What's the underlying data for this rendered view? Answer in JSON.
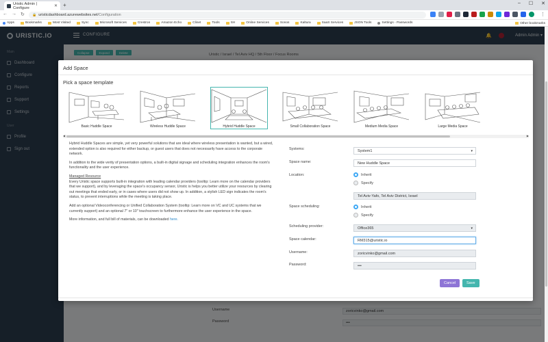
{
  "browser": {
    "tab_title": "Uristic Admin | Configure",
    "url_host": "uristicdashboard.azurewebsites.net",
    "url_path": "/Configuration",
    "bookmarks": [
      "Apps",
      "Bookmarks",
      "Most Visited",
      "Sync",
      "Microsoft Services",
      "Crestron",
      "Amazon Echo",
      "Clinet",
      "Tools",
      "SH",
      "Online Services",
      "Sonos",
      "Kaltura",
      "SaaS Services",
      "JSON Tools",
      "Settings - Passwords"
    ],
    "other_bookmarks": "Other bookmarks"
  },
  "app": {
    "logo": "URISTIC.IO",
    "page_header": "CONFIGURE",
    "user_name": "Admin Admin",
    "sidebar": {
      "main_section": "Main",
      "main_items": [
        "Dashboard",
        "Configure",
        "Reports",
        "Support",
        "Settings"
      ],
      "user_section": "User",
      "user_items": [
        "Profile",
        "Sign out"
      ]
    },
    "breadcrumb": "Uristic  /  Israel  /  Tel Aviv HQ  /  5th Floor  /  Focus Rooms",
    "bg_buttons": [
      "Collapse",
      "Expand",
      "Delete"
    ],
    "bg_rows": [
      {
        "label": "Username",
        "value": "zoricvinko@gmail.com"
      },
      {
        "label": "Password",
        "value": "•••"
      }
    ]
  },
  "modal": {
    "title": "Add Space",
    "pick_title": "Pick a space template",
    "templates": [
      {
        "name": "Basic Huddle Space",
        "selected": false
      },
      {
        "name": "Wireless Huddle Space",
        "selected": false
      },
      {
        "name": "Hybrid Huddle Space",
        "selected": true
      },
      {
        "name": "Small Collaboration Space",
        "selected": false
      },
      {
        "name": "Medium Media Space",
        "selected": false
      },
      {
        "name": "Large Media Space",
        "selected": false
      }
    ],
    "description": {
      "p1": "Hybrid Huddle Spaces are simple, yet very powerful solutions that are ideal where wireless presentation is wanted, but a wired, extended option is also required for either backup, or guest users that does not necessarily have access to the corporate network.",
      "p2": "In addition to the wide verity of presentation options, a built-in digital signage and scheduling integration enhances the room's functionality and the user experience.",
      "managed_heading": "Managed Resource",
      "p3": "Every Uristic space supports built-in integration with leading calendar providers (tooltip: Learn more on the calendar providers that we support), and by leveraging the space's occupancy sensor, Uristic is helps you better utilize your resources by clearing out meetings that ended early, or in cases where users did not show up. In addition, a stylish LED sign indicates the room's status, to prevent interruptions while the meeting is taking place.",
      "p4": "Add an optional Videoconferencing or Unified Collaboration System (tooltip: Learn more on VC and UC systems that we currently support) and an optional 7\" or 10\" touchscreen to furthermore enhance the user experience in the space.",
      "p5_text": "More information, and full bill of materials, can be downloaded",
      "p5_link": "here."
    },
    "form": {
      "systems_label": "Systems:",
      "systems_value": "System1",
      "space_name_label": "Space name:",
      "space_name_value": "New Huddle Space",
      "location_label": "Location:",
      "location_options": [
        "Inherit",
        "Specify"
      ],
      "location_selected": "Inherit",
      "location_value": "Tel Aviv-Yafo, Tel Aviv District, Israel",
      "scheduling_label": "Space scheduling:",
      "scheduling_options": [
        "Inherit",
        "Specify"
      ],
      "scheduling_selected": "Inherit",
      "provider_label": "Scheduling provider:",
      "provider_value": "Office365",
      "calendar_label": "Space calendar:",
      "calendar_value": "RM315@uristic.io",
      "username_label": "Username:",
      "username_value": "zoricvinko@gmail.com",
      "password_label": "Password:",
      "password_value": "•••"
    },
    "cancel_label": "Cancel",
    "save_label": "Save"
  },
  "colors": {
    "sidebar": "#2c3e50",
    "accent_teal": "#44b6ae",
    "cancel_purple": "#8e75d6",
    "radio_blue": "#3fa9f5"
  }
}
